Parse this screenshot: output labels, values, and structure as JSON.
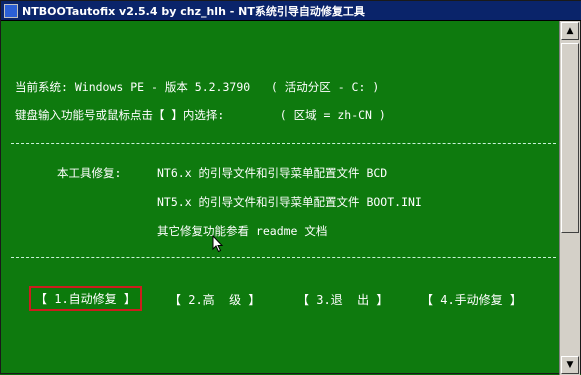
{
  "window": {
    "title": "NTBOOTautofix v2.5.4 by chz_hlh - NT系统引导自动修复工具"
  },
  "status": {
    "system_line": "当前系统: Windows PE - 版本 5.2.3790   ( 活动分区 - C: )",
    "input_line": "键盘输入功能号或鼠标点击【 】内选择:        ( 区域 = zh-CN )"
  },
  "info": {
    "label": "本工具修复:",
    "item1": "NT6.x 的引导文件和引导菜单配置文件 BCD",
    "item2": "NT5.x 的引导文件和引导菜单配置文件 BOOT.INI",
    "item3": "其它修复功能参看 readme 文档"
  },
  "menu": [
    {
      "label": "【 1.自动修复 】",
      "selected": true
    },
    {
      "label": "【 2.高  级 】",
      "selected": false
    },
    {
      "label": "【 3.退  出 】",
      "selected": false
    },
    {
      "label": "【 4.手动修复 】",
      "selected": false
    }
  ],
  "colors": {
    "background": "#0e7a0e",
    "selection_border": "#cc1d1d",
    "titlebar": "#0a246a"
  }
}
